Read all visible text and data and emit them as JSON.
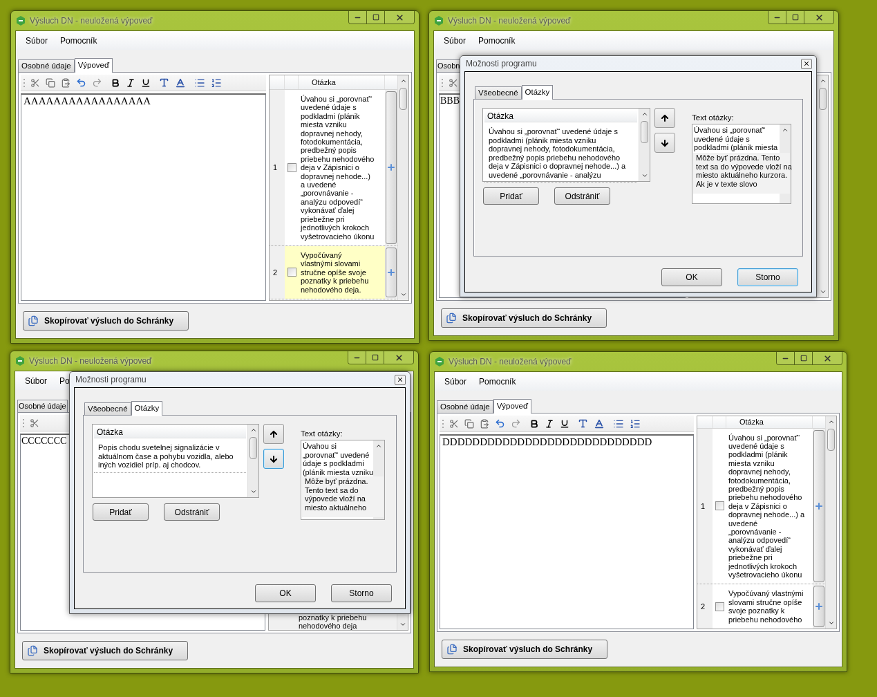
{
  "windows": [
    {
      "title": "Výsluch DN - neuložená výpoveď",
      "menu": [
        "Súbor",
        "Pomocník"
      ],
      "tabs": [
        {
          "label": "Osobné údaje",
          "selected": false
        },
        {
          "label": "Výpoveď",
          "selected": true
        }
      ],
      "editor_text": "AAAAAAAAAAAAAAAAA",
      "grid": {
        "header": "Otázka",
        "rows": [
          {
            "number": "1",
            "checked": false,
            "selected": false,
            "lines": [
              "Úvahou si „porovnať“",
              "uvedené údaje s",
              "podkladmi (plánik",
              "miesta vzniku",
              "dopravnej nehody,",
              "fotodokumentácia,",
              "predbežný popis",
              "priebehu nehodového",
              "deja v Zápisnici o",
              "dopravnej nehode...)",
              "a uvedené",
              "„porovnávanie -",
              "analýzu odpovedí“",
              "vykonávať ďalej",
              "priebežne pri",
              "jednotlivých krokoch",
              "vyšetrovacieho úkonu"
            ]
          },
          {
            "number": "2",
            "checked": false,
            "selected": true,
            "lines": [
              "Vypočúvaný",
              "vlastnými slovami",
              "stručne opíše svoje",
              "poznatky k priebehu",
              "nehodového deja."
            ]
          }
        ]
      },
      "copy_button": "Skopírovať výsluch do Schránky"
    },
    {
      "title": "Výsluch DN - neuložená výpoveď",
      "menu": [
        "Súbor",
        "Pomocník"
      ],
      "tabs": [
        {
          "label": "Osobn",
          "selected": false
        }
      ],
      "editor_text": "BBB",
      "copy_button": "Skopírovať výsluch do Schránky",
      "dialog": {
        "title": "Možnosti programu",
        "tabs": [
          {
            "label": "Všeobecné",
            "selected": false
          },
          {
            "label": "Otázky",
            "selected": true
          }
        ],
        "list_header": "Otázka",
        "list_lines": [
          "Úvahou si „porovnať“ uvedené údaje s",
          "podkladmi (plánik miesta vzniku",
          "dopravnej nehody, fotodokumentácia,",
          "predbežný popis priebehu nehodového",
          "deja v Zápisnici o dopravnej nehode...) a",
          "uvedené  „porovnávanie - analýzu"
        ],
        "move_buttons": [
          {
            "kind": "up",
            "focused": false
          },
          {
            "kind": "down",
            "focused": false
          }
        ],
        "list_buttons": [
          "Pridať",
          "Odstrániť"
        ],
        "text_label": "Text otázky:",
        "text_lines": [
          "Úvahou si „porovnať“",
          "uvedené údaje s",
          "podkladmi (plánik miesta"
        ],
        "tooltip_lines": [
          "Môže byť prázdna. Tento",
          "text sa do výpovede vloží na",
          "miesto aktuálneho kurzora.",
          "Ak je v texte slovo"
        ],
        "footer_buttons": [
          {
            "label": "OK",
            "focused": false
          },
          {
            "label": "Storno",
            "focused": true
          }
        ]
      }
    },
    {
      "title": "Výsluch DN - neuložená výpoveď",
      "menu": [
        "Súbor",
        "Po"
      ],
      "tabs": [
        {
          "label": "Osobné údaje",
          "selected": false
        }
      ],
      "editor_text": "CCCCCCC",
      "grid": {
        "fragment": [
          "poznatky k priebehu",
          "nehodového deja"
        ]
      },
      "copy_button": "Skopírovať výsluch do Schránky",
      "dialog": {
        "title": "Možnosti programu",
        "tabs": [
          {
            "label": "Všeobecné",
            "selected": false
          },
          {
            "label": "Otázky",
            "selected": true
          }
        ],
        "list_header": "Otázka",
        "list_lines": [
          "Popis chodu svetelnej signalizácie v",
          "aktuálnom čase a pohybu vozidla, alebo",
          "iných vozidiel príp. aj chodcov."
        ],
        "move_buttons": [
          {
            "kind": "up",
            "focused": false
          },
          {
            "kind": "down",
            "focused": true
          }
        ],
        "list_buttons": [
          "Pridať",
          "Odstrániť"
        ],
        "text_label": "Text otázky:",
        "text_lines": [
          "Úvahou si",
          "„porovnať“ uvedené",
          "údaje s podkladmi",
          "(plánik miesta vzniku"
        ],
        "tooltip_lines": [
          "Môže byť prázdna.",
          "Tento text sa do",
          "výpovede vloží na",
          "miesto aktuálneho"
        ],
        "footer_buttons": [
          {
            "label": "OK",
            "focused": false
          },
          {
            "label": "Storno",
            "focused": false
          }
        ]
      }
    },
    {
      "title": "Výsluch DN - neuložená výpoveď",
      "menu": [
        "Súbor",
        "Pomocník"
      ],
      "tabs": [
        {
          "label": "Osobné údaje",
          "selected": false
        },
        {
          "label": "Výpoveď",
          "selected": true
        }
      ],
      "editor_text": "DDDDDDDDDDDDDDDDDDDDDDDDDDDD",
      "grid": {
        "header": "Otázka",
        "rows": [
          {
            "number": "1",
            "checked": false,
            "selected": false,
            "lines": [
              "Úvahou si „porovnať“",
              "uvedené údaje s",
              "podkladmi (plánik",
              "miesta vzniku",
              "dopravnej nehody,",
              "fotodokumentácia,",
              "predbežný popis",
              "priebehu nehodového",
              "deja v Zápisnici o",
              "dopravnej nehode...) a",
              "uvedené",
              "„porovnávanie -",
              "analýzu odpovedí“",
              "vykonávať ďalej",
              "priebežne pri",
              "jednotlivých krokoch",
              "vyšetrovacieho úkonu"
            ]
          },
          {
            "number": "2",
            "checked": false,
            "selected": false,
            "lines": [
              "Vypočúvaný vlastnými",
              "slovami stručne opíše",
              "svoje poznatky k",
              "priebehu nehodového"
            ]
          }
        ]
      },
      "copy_button": "Skopírovať výsluch do Schránky"
    }
  ]
}
